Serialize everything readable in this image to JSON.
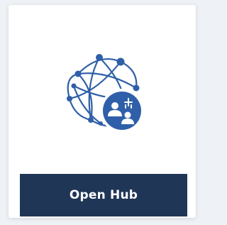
{
  "card": {
    "icon": "network-community-icon",
    "button_label": "Open Hub"
  },
  "colors": {
    "accent": "#2f5fa8",
    "button_bg": "#1f3656",
    "button_text": "#ffffff"
  }
}
